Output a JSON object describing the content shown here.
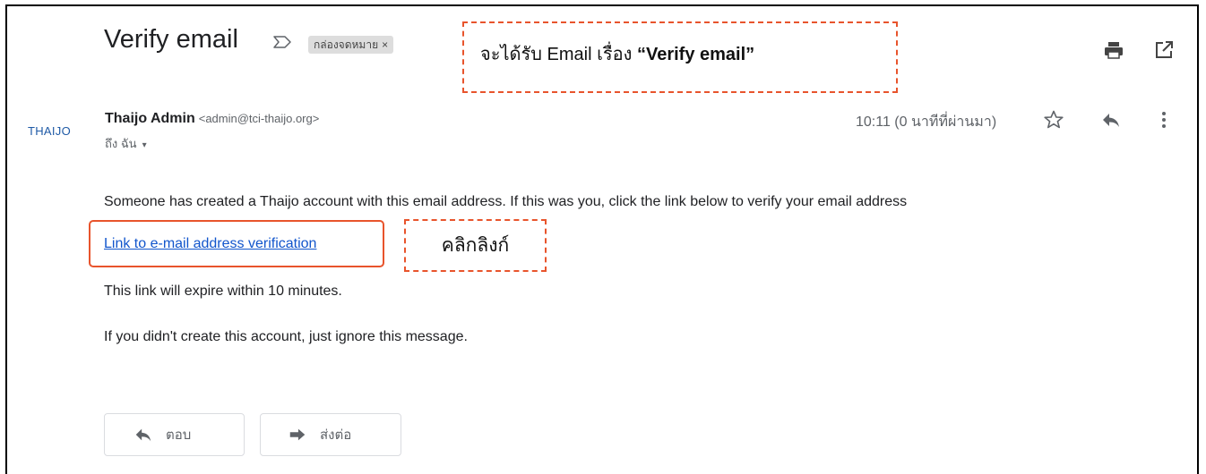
{
  "email": {
    "subject": "Verify email",
    "label_chip": "กล่องจดหมาย",
    "label_chip_close": "×",
    "sender": {
      "logo_text": "THAIJO",
      "name": "Thaijo Admin",
      "email": "<admin@tci-thaijo.org>",
      "to_label": "ถึง ฉัน",
      "to_caret": "▾"
    },
    "timestamp": "10:11 (0 นาทีที่ผ่านมา)",
    "body": {
      "line1": "Someone has created a Thaijo account with this email address. If this was you, click the link below to verify your email address",
      "link_text": "Link to e-mail address verification",
      "line3": "This link will expire within 10 minutes.",
      "line4": "If you didn't create this account, just ignore this message."
    },
    "actions": {
      "reply_label": "ตอบ",
      "forward_label": "ส่งต่อ"
    }
  },
  "annotations": {
    "subject_callout_prefix": "จะได้รับ Email เรื่อง ",
    "subject_callout_bold": "“Verify email”",
    "click_callout": "คลิกลิงก์"
  },
  "icons": {
    "important": "important-marker-icon",
    "print": "print-icon",
    "new_window": "open-in-new-window-icon",
    "star": "star-icon",
    "reply": "reply-icon",
    "more": "more-vertical-icon",
    "forward": "forward-icon"
  },
  "colors": {
    "link": "#1155cc",
    "callout_border": "#e8542c",
    "logo": "#1f5aa6",
    "chip_bg": "#dddddd"
  }
}
